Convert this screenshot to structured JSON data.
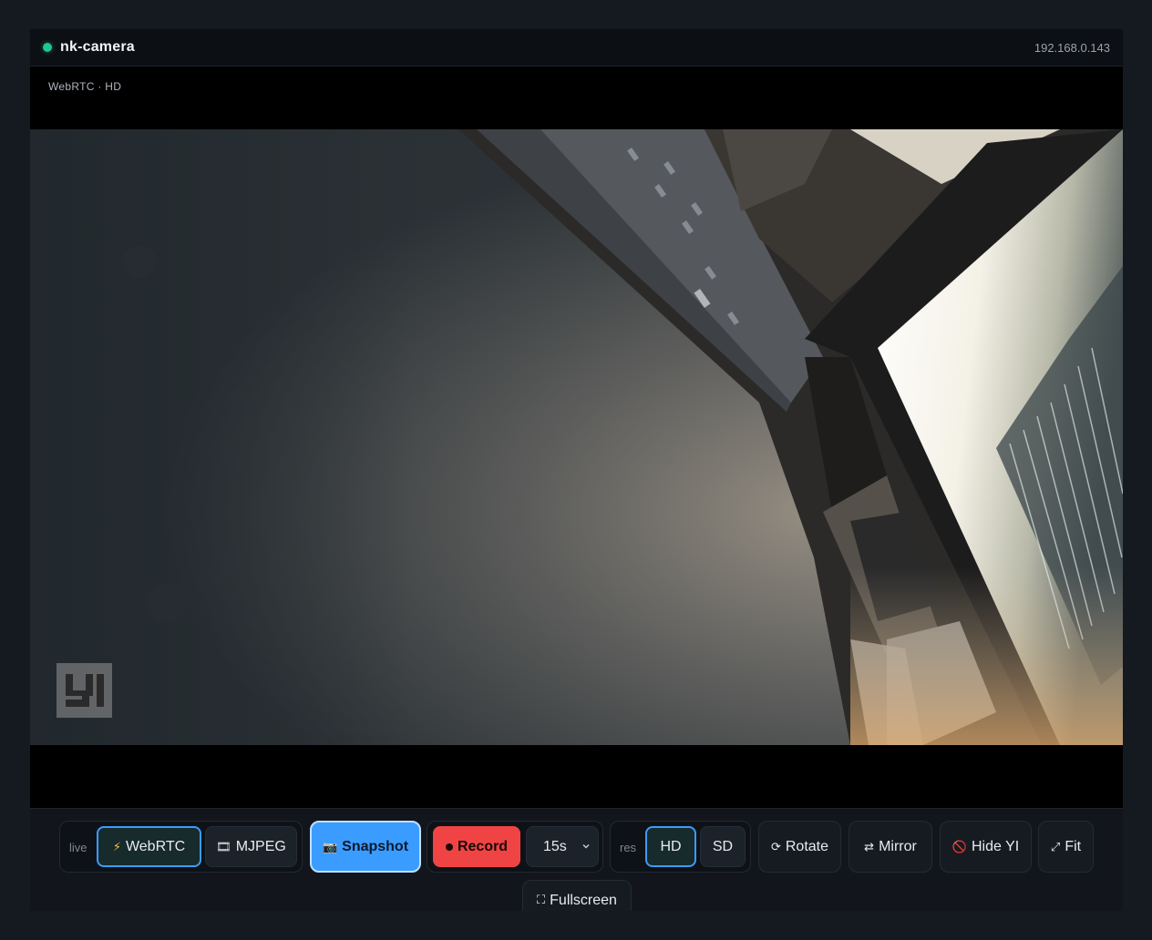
{
  "app": {
    "title": "nk-camera",
    "ip": "192.168.0.143",
    "status_color": "#22c58b"
  },
  "stream": {
    "label": "WebRTC · HD",
    "watermark_text": "YI"
  },
  "controls": {
    "live_label": "live",
    "webrtc_label": "WebRTC",
    "webrtc_icon": "lightning-icon",
    "mjpeg_label": "MJPEG",
    "mjpeg_icon": "film-icon",
    "snapshot_label": "Snapshot",
    "snapshot_icon": "camera-icon",
    "record_label": "Record",
    "duration_value": "15s",
    "res_label": "res",
    "hd_label": "HD",
    "sd_label": "SD",
    "rotate_label": "Rotate",
    "rotate_icon": "rotate-icon",
    "mirror_label": "Mirror",
    "mirror_icon": "swap-arrows-icon",
    "hide_yi_label": "Hide YI",
    "hide_yi_icon": "no-entry-icon",
    "fit_label": "Fit",
    "fit_icon": "expand-icon",
    "fullscreen_label": "Fullscreen",
    "fullscreen_icon": "fullscreen-icon",
    "active_mode": "WebRTC",
    "active_res": "HD",
    "accent_color": "#3b9cff",
    "record_color": "#f04444"
  }
}
